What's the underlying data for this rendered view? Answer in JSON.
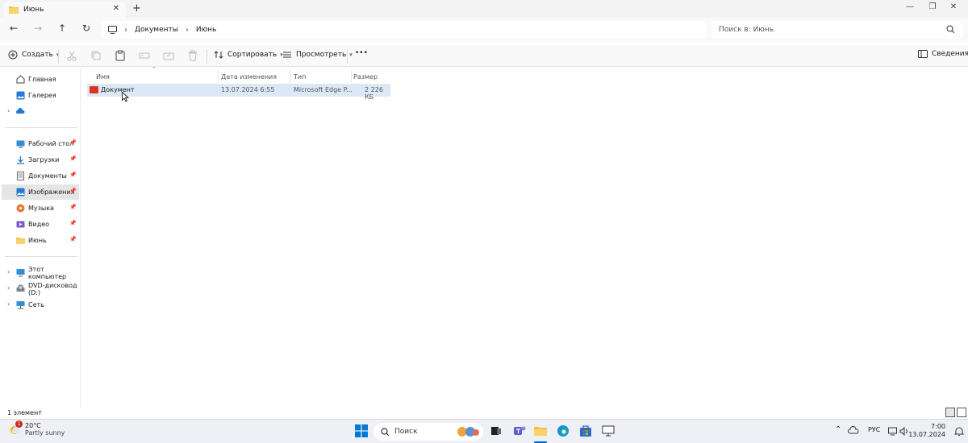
{
  "window": {
    "tab_title": "Июнь",
    "new_tab": "+",
    "close_tab": "✕"
  },
  "nav": {
    "breadcrumb": [
      "Документы",
      "Июнь"
    ],
    "search_placeholder": "Поиск в: Июнь"
  },
  "toolbar": {
    "create": "Создать",
    "sort": "Сортировать",
    "view": "Просмотреть",
    "more": "•••",
    "details": "Сведения"
  },
  "sidebar": {
    "quick": [
      {
        "label": "Главная",
        "icon": "home-icon"
      },
      {
        "label": "Галерея",
        "icon": "gallery-icon"
      }
    ],
    "pinned": [
      {
        "label": "Рабочий стол",
        "icon": "desktop-icon"
      },
      {
        "label": "Загрузки",
        "icon": "downloads-icon"
      },
      {
        "label": "Документы",
        "icon": "documents-icon"
      },
      {
        "label": "Изображения",
        "icon": "pictures-icon"
      },
      {
        "label": "Музыка",
        "icon": "music-icon"
      },
      {
        "label": "Видео",
        "icon": "video-icon"
      },
      {
        "label": "Июнь",
        "icon": "folder-icon"
      }
    ],
    "devices": [
      {
        "label": "Этот компьютер",
        "icon": "computer-icon"
      },
      {
        "label": "DVD-дисковод (D:)",
        "icon": "dvd-icon"
      },
      {
        "label": "Сеть",
        "icon": "network-icon"
      }
    ]
  },
  "columns": {
    "name": "Имя",
    "date": "Дата изменения",
    "type": "Тип",
    "size": "Размер"
  },
  "files": [
    {
      "name": "Документ",
      "date": "13.07.2024 6:55",
      "type": "Microsoft Edge P...",
      "size": "2 226 КБ"
    }
  ],
  "status": {
    "count": "1 элемент"
  },
  "taskbar": {
    "weather_temp": "20°C",
    "weather_cond": "Partly sunny",
    "weather_badge": "1",
    "search": "Поиск",
    "lang": "РУС",
    "time": "7:00",
    "date": "13.07.2024"
  },
  "colors": {
    "selected_row": "#dde8f6",
    "accent": "#0067c0",
    "pdf_red": "#d9361c",
    "folder_yellow": "#f2c14e"
  }
}
